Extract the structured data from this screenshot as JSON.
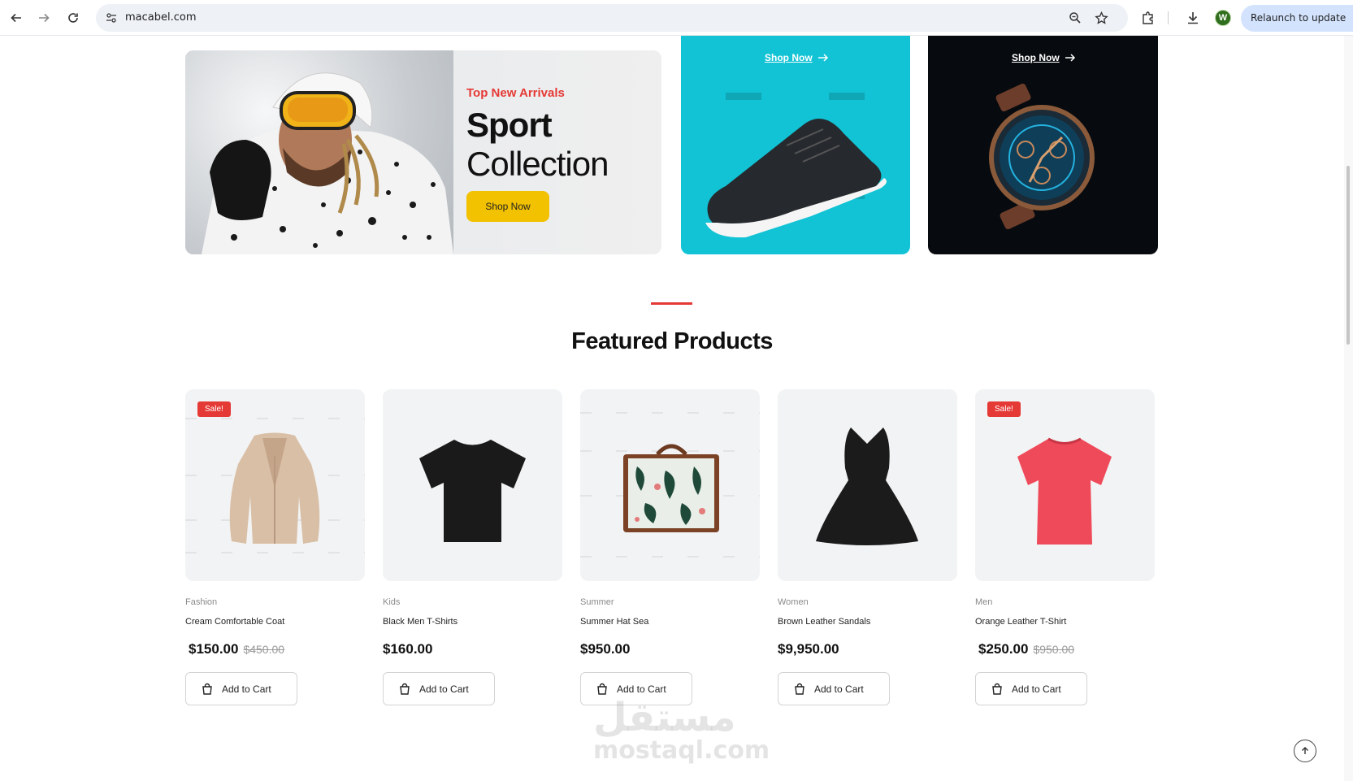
{
  "browser": {
    "url": "macabel.com",
    "relaunch_label": "Relaunch to update",
    "avatar_letter": "W",
    "icons": [
      "back-icon",
      "forward-icon",
      "reload-icon",
      "site-info-icon",
      "zoom-icon",
      "bookmark-star-icon",
      "extensions-icon",
      "download-icon"
    ]
  },
  "banners": {
    "main": {
      "tag": "Top New Arrivals",
      "title": "Sport",
      "subtitle": "Collection",
      "button": "Shop Now"
    },
    "shoe": {
      "link": "Shop Now"
    },
    "watch": {
      "link": "Shop Now"
    }
  },
  "section": {
    "title": "Featured Products"
  },
  "products": [
    {
      "category": "Fashion",
      "name": "Cream Comfortable Coat",
      "price": "$150.00",
      "old_price": "$450.00",
      "sale": "Sale!",
      "cart": "Add to Cart"
    },
    {
      "category": "Kids",
      "name": "Black Men T-Shirts",
      "price": "$160.00",
      "old_price": "",
      "sale": "",
      "cart": "Add to Cart"
    },
    {
      "category": "Summer",
      "name": "Summer Hat Sea",
      "price": "$950.00",
      "old_price": "",
      "sale": "",
      "cart": "Add to Cart"
    },
    {
      "category": "Women",
      "name": "Brown Leather Sandals",
      "price": "$9,950.00",
      "old_price": "",
      "sale": "",
      "cart": "Add to Cart"
    },
    {
      "category": "Men",
      "name": "Orange Leather T-Shirt",
      "price": "$250.00",
      "old_price": "$950.00",
      "sale": "Sale!",
      "cart": "Add to Cart"
    }
  ],
  "watermark": {
    "arabic": "مستقل",
    "latin": "mostaql.com"
  },
  "colors": {
    "accent_red": "#e53935",
    "button_yellow": "#f2c100",
    "shoe_bg": "#11c3d5",
    "watch_bg": "#070a0e"
  }
}
